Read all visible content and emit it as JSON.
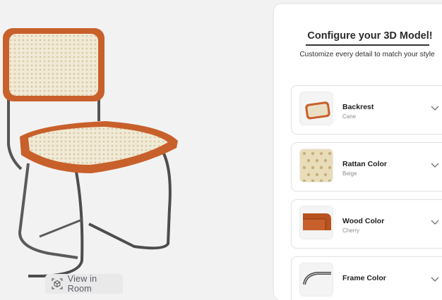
{
  "viewer": {
    "ar_button_label": "View in Room",
    "ar_icon": "view-in-room-icon"
  },
  "configurator": {
    "title": "Configure your 3D Model!",
    "subtitle": "Customize every detail to match your style",
    "options": [
      {
        "name": "Backrest",
        "value": "Cane",
        "thumb_icon": "backrest-thumbnail"
      },
      {
        "name": "Rattan Color",
        "value": "Beige",
        "thumb_icon": "rattan-swatch"
      },
      {
        "name": "Wood Color",
        "value": "Cherry",
        "thumb_icon": "wood-swatch"
      },
      {
        "name": "Frame Color",
        "value": "",
        "thumb_icon": "frame-thumbnail"
      }
    ]
  },
  "colors": {
    "wood": "#c8602b",
    "cane": "#efe7d2",
    "chrome": "#6a6a6a",
    "accent_text": "#2c2c2c"
  }
}
